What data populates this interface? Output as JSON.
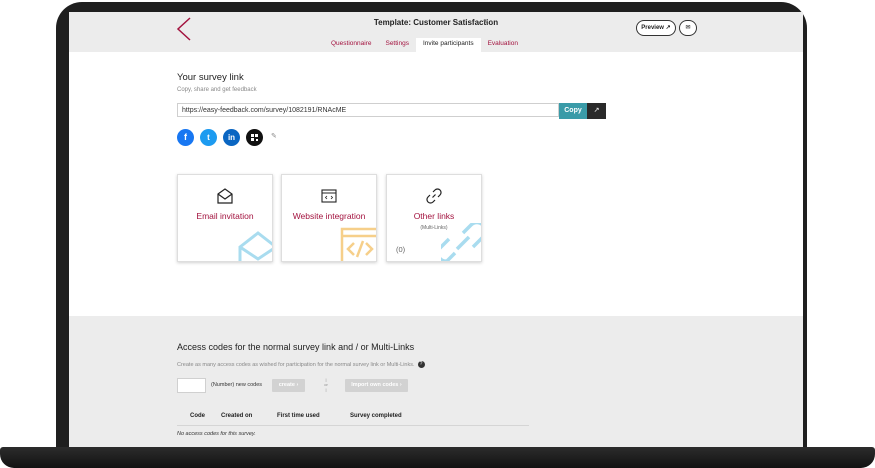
{
  "header": {
    "title": "Template: Customer Satisfaction",
    "preview_label": "Preview",
    "tabs": [
      {
        "label": "Questionnaire"
      },
      {
        "label": "Settings"
      },
      {
        "label": "Invite participants"
      },
      {
        "label": "Evaluation"
      }
    ],
    "active_tab": "Invite participants"
  },
  "survey_link": {
    "heading": "Your survey link",
    "subtitle": "Copy, share and get feedback",
    "url": "https://easy-feedback.com/survey/1082191/RNAcME",
    "copy_label": "Copy"
  },
  "share_icons": [
    "facebook-icon",
    "twitter-icon",
    "linkedin-icon",
    "qr-code-icon"
  ],
  "cards": [
    {
      "label": "Email invitation",
      "icon": "envelope-icon"
    },
    {
      "label": "Website integration",
      "icon": "code-window-icon"
    },
    {
      "label": "Other links",
      "sub": "(Multi-Links)",
      "count": "(0)",
      "icon": "link-icon"
    }
  ],
  "access_codes": {
    "heading": "Access codes for the normal survey link and / or Multi-Links",
    "description": "Create as many access codes as wished for participation for the normal survey link or Multi-Links.",
    "help": "?",
    "new_codes_label": "(Number) new codes",
    "create_label": "create",
    "or_label": "or",
    "import_label": "Import own codes",
    "columns": [
      "Code",
      "Created on",
      "First time used",
      "Survey completed"
    ],
    "empty_text": "No access codes for this survey."
  },
  "colors": {
    "brand": "#a3133f",
    "copy_button": "#3a9ba8",
    "facebook": "#1877f2",
    "twitter": "#1d9bf0",
    "linkedin": "#0a66c2"
  }
}
